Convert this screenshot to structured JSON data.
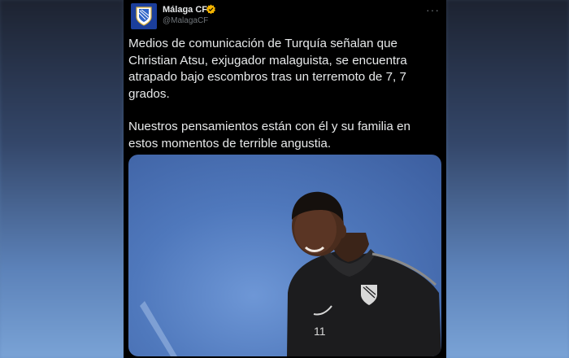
{
  "tweet": {
    "author_name": "Málaga CF",
    "handle": "@MalagaCF",
    "more_icon": "ellipsis-icon",
    "verified_icon": "verified-badge-icon",
    "paragraphs": [
      "Medios de comunicación de Turquía señalan que Christian Atsu, exjugador malaguista, se encuentra atrapado bajo escombros tras un terremoto de 7, 7 grados.",
      "Nuestros pensamientos están con él y su familia en estos momentos de terrible angustia."
    ],
    "media": {
      "jersey_number": "11"
    }
  },
  "colors": {
    "background": "#000000",
    "text": "#e7e9ea",
    "secondary_text": "#71767b",
    "verified": "#f4b400",
    "avatar_bg": "#1b3e9b"
  }
}
